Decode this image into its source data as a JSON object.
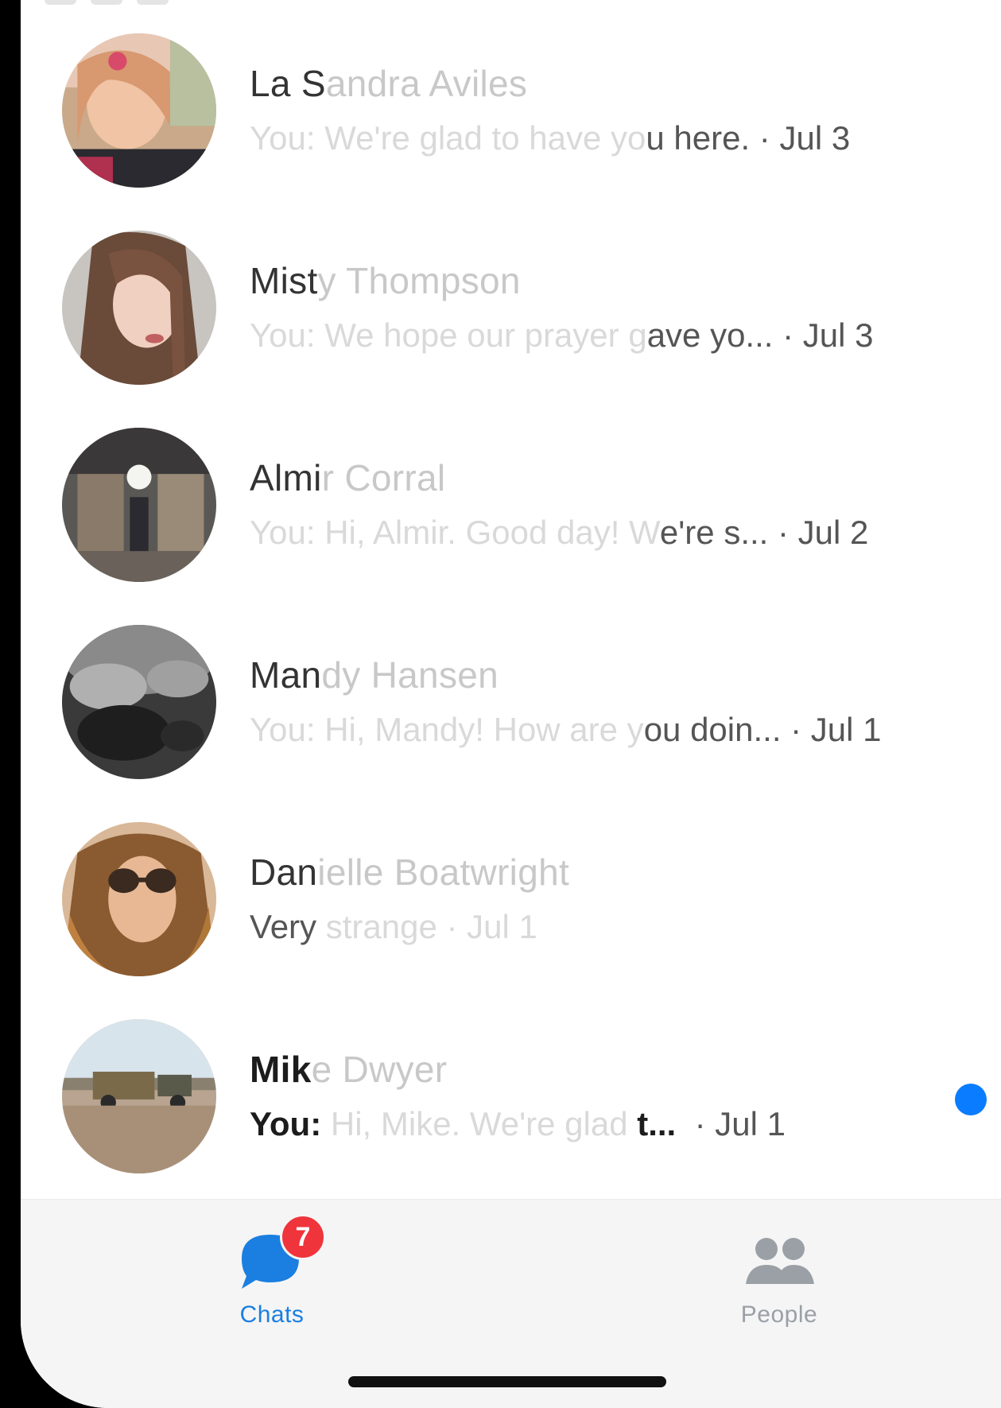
{
  "chats": [
    {
      "name_strong": "La S",
      "name_faded": "andra Aviles",
      "preview_faded": "You: We're glad to have yo",
      "preview_strong": "u here. · Jul 3",
      "unread": false
    },
    {
      "name_strong": "Mist",
      "name_faded": "y Thompson",
      "preview_faded": "You: We hope our prayer g",
      "preview_strong": "ave yo... · Jul 3",
      "unread": false
    },
    {
      "name_strong": "Almi",
      "name_faded": "r Corral",
      "preview_faded": "You: Hi, Almir. Good day! W",
      "preview_strong": "e're s... · Jul 2",
      "unread": false
    },
    {
      "name_strong": "Man",
      "name_faded": "dy Hansen",
      "preview_faded": "You: Hi, Mandy! How are y",
      "preview_strong": "ou doin... · Jul 1",
      "unread": false
    },
    {
      "name_strong": "Dan",
      "name_faded": "ielle Boatwright",
      "preview_strong_first": "Very",
      "preview_faded_after": " strange · Jul 1",
      "unread": false
    },
    {
      "name_strong": "Mik",
      "name_faded": "e Dwyer",
      "preview_strong_first": "You:",
      "preview_faded_mid": " Hi, Mike. We're glad ",
      "preview_strong": "t...",
      "date": "  · Jul 1",
      "unread": true
    }
  ],
  "tabs": {
    "chats_label": "Chats",
    "chats_badge": "7",
    "people_label": "People"
  },
  "colors": {
    "accent": "#0a7cff",
    "badge": "#f0343c"
  }
}
